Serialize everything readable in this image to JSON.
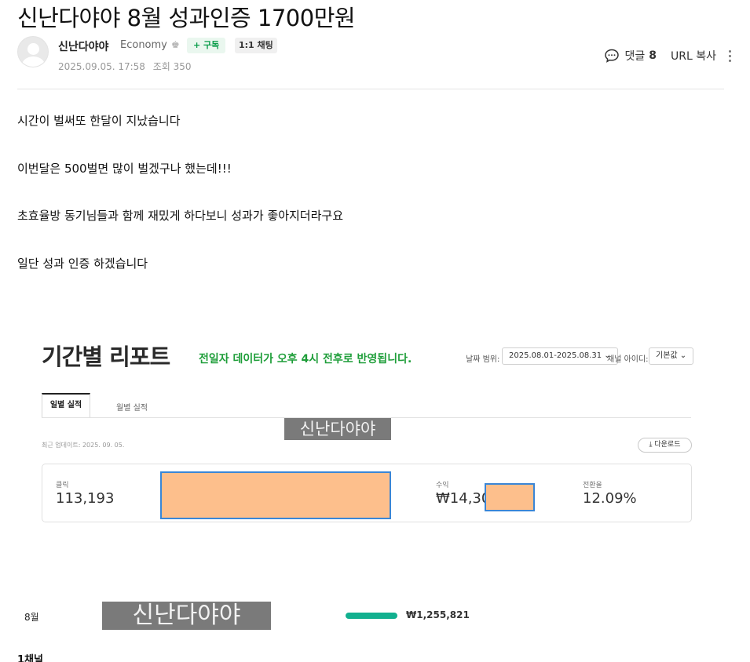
{
  "post": {
    "title": "신난다야야 8월 성과인증 1700만원",
    "author": {
      "nickname": "신난다야야",
      "grade": "Economy",
      "grade_icon": "crown-icon",
      "subscribe_label": "+ 구독",
      "chat_label": "1:1 채팅"
    },
    "date": "2025.09.05. 17:58",
    "views_label": "조회 350",
    "comments_label": "댓글",
    "comments_count": "8",
    "url_copy_label": "URL 복사",
    "paragraphs": [
      "시간이 벌써또 한달이 지났습니다",
      "이번달은 500벌면 많이 벌겠구나 했는데!!!",
      "초효율방 동기님들과 함께 재밌게 하다보니 성과가 좋아지더라구요",
      "일단 성과 인증 하겠습니다"
    ]
  },
  "report": {
    "title": "기간별 리포트",
    "notice": "전일자 데이터가 오후 4시 전후로 반영됩니다.",
    "date_range_label": "날짜 범위:",
    "date_range_value": "2025.08.01-2025.08.31 ⌄",
    "channel_label": "채널 아이디:",
    "channel_value": "기본값 ⌄",
    "tabs": [
      "일별 실적",
      "월별 실적"
    ],
    "watermark": "신난다야야",
    "updated": "최근 업데이트: 2025. 09. 05.",
    "download_label": "⤓ 다운로드",
    "stats": {
      "clicks_label": "클릭",
      "clicks_value": "113,193",
      "revenue_label": "수익",
      "revenue_value": "₩14,30",
      "conversion_label": "전환율",
      "conversion_value": "12.09%"
    }
  },
  "monthly": {
    "month": "8월",
    "watermark": "신난다야야",
    "amount": "₩1,255,821",
    "bar_color": "#12b08f"
  },
  "channel_count": "1채널"
}
